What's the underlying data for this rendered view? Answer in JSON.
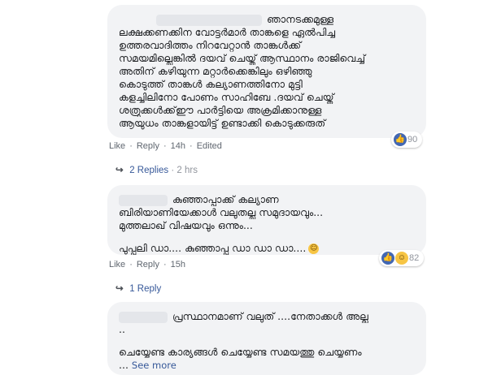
{
  "comment1": {
    "lines": [
      "ഞാനടക്കമുള്ള",
      "ലക്ഷക്കണക്കിന വോട്ടർമാർ താങ്കളെ ഏൽപിച്ച",
      "ഉത്തരവാദിത്തം നിറവേറ്റാൻ താങ്കൾക്ക്",
      "സമയമില്ലെങ്കിൽ ദയവ് ചെയ്ത് ആസ്ഥാനം രാജിവെച്ച്",
      "അതിന് കഴിയുന്ന മറ്റാർക്കെങ്കിലും ഒഴിഞ്ഞു",
      "കൊടുത്ത് താങ്കൾ കല്യാണത്തിനോ മുട്ടി",
      "കളച്ചിലിനോ പോണം സാഹിബേ .ദയവ് ചെയ്ത്",
      "ശത്രുക്കൾക്ക്ഈ പാർട്ടിയെ അക്രമിക്കാനുള്ള",
      "ആയുധം താങ്കളായിട്ട് ഉണ്ടാക്കി കൊടുക്കരുത്"
    ],
    "reaction_count": "90",
    "like": "Like",
    "reply": "Reply",
    "time": "14h",
    "edited": "Edited",
    "replies_label": "2 Replies",
    "replies_time": "2 hrs"
  },
  "comment2": {
    "lines": [
      "കുഞ്ഞാപ്പാക്ക് കല്യാണ",
      "ബിരിയാണിയേക്കാൾ വലുതല്ല സമുദായവും...",
      "മുത്തലാഖ് വിഷയവും ഒന്നും..."
    ],
    "last_line": "പുപ്പുലി ഡാ.... കുഞ്ഞാപ്പ ഡാ ഡാ ഡാ....",
    "reaction_count": "82",
    "like": "Like",
    "reply": "Reply",
    "time": "15h",
    "replies_label": "1 Reply"
  },
  "comment3": {
    "line1": "പ്രസ്ഥാനമാണ് വലുത് ....നേതാക്കൾ അല്ല",
    "line2": "..",
    "line3": "ചെയ്യേണ്ട കാര്യങ്ങൾ ചെയ്യേണ്ട സമയത്തു ചെയ്യണം",
    "line4_prefix": "...",
    "see_more": "See more"
  }
}
